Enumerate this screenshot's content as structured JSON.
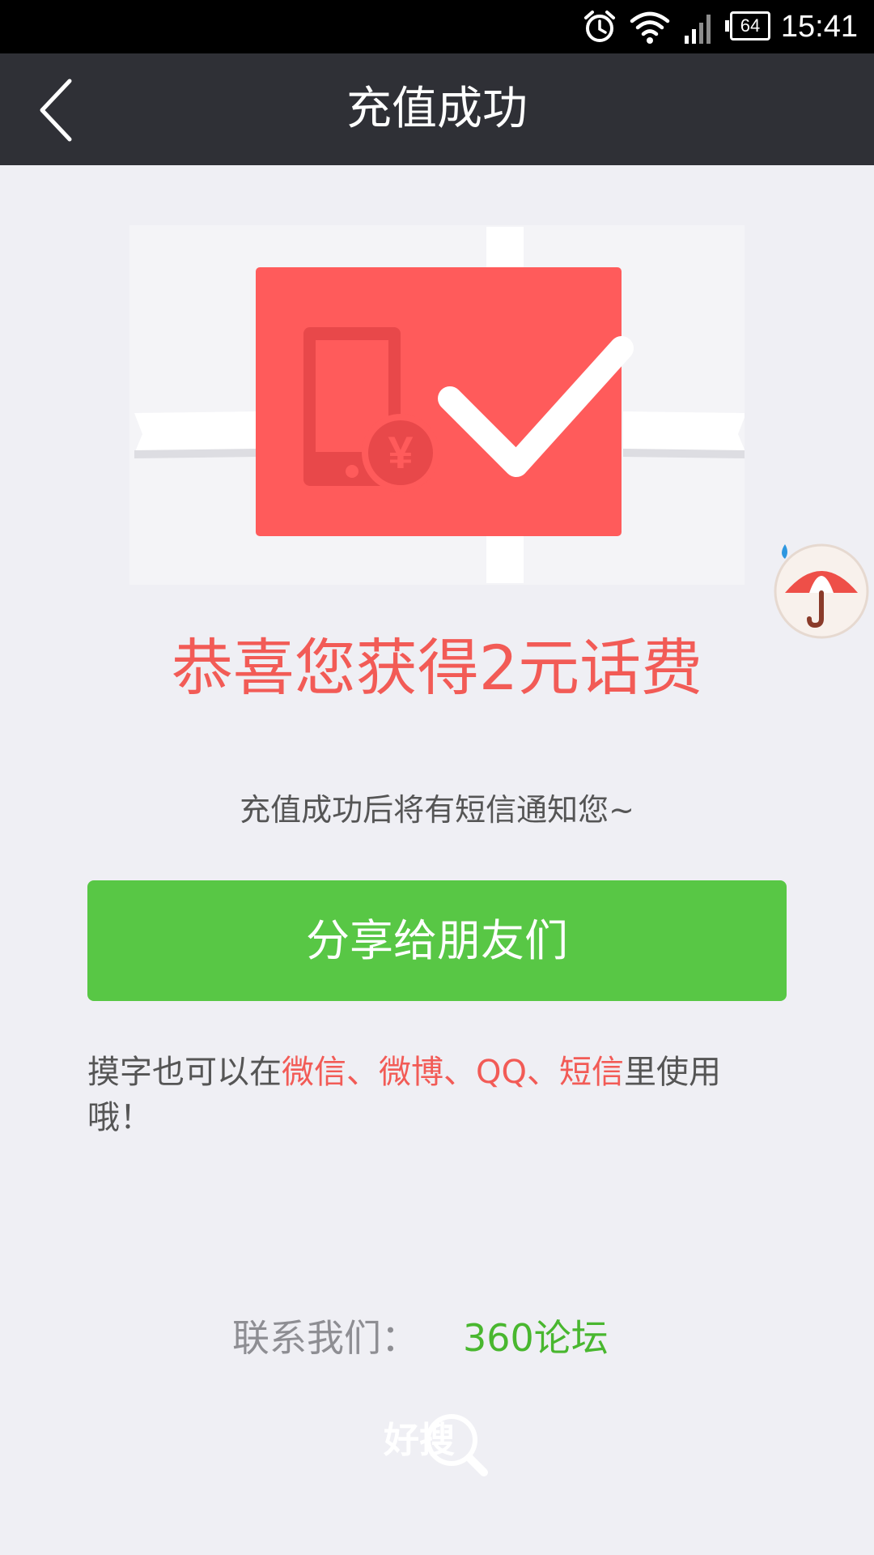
{
  "status_bar": {
    "battery": "64",
    "time": "15:41",
    "icons": [
      "alarm-icon",
      "wifi-icon",
      "signal-icon",
      "battery-icon"
    ]
  },
  "header": {
    "title": "充值成功",
    "back_icon": "chevron-left-icon"
  },
  "hero": {
    "currency_symbol": "¥",
    "icons": [
      "phone-icon",
      "yuan-coin-icon",
      "checkmark-icon",
      "ribbon-icon"
    ]
  },
  "floating_widget": {
    "icon": "umbrella-icon"
  },
  "main": {
    "congrats": "恭喜您获得2元话费",
    "sms_note": "充值成功后将有短信通知您~",
    "share_button": "分享给朋友们",
    "usage_tip": {
      "prefix": "摸字也可以在",
      "app1": "微信",
      "sep1": "、",
      "app2": "微博",
      "sep2": "、",
      "app3": "QQ",
      "sep3": "、",
      "app4": "短信",
      "suffix": "里使用哦！"
    }
  },
  "footer": {
    "contact_label": "联系我们：",
    "contact_link": "360论坛",
    "brand": "好搜"
  },
  "colors": {
    "accent_red": "#f25b56",
    "button_green": "#58c745",
    "link_green": "#49b72f",
    "title_bar": "#2f3036",
    "background": "#efeff4"
  }
}
